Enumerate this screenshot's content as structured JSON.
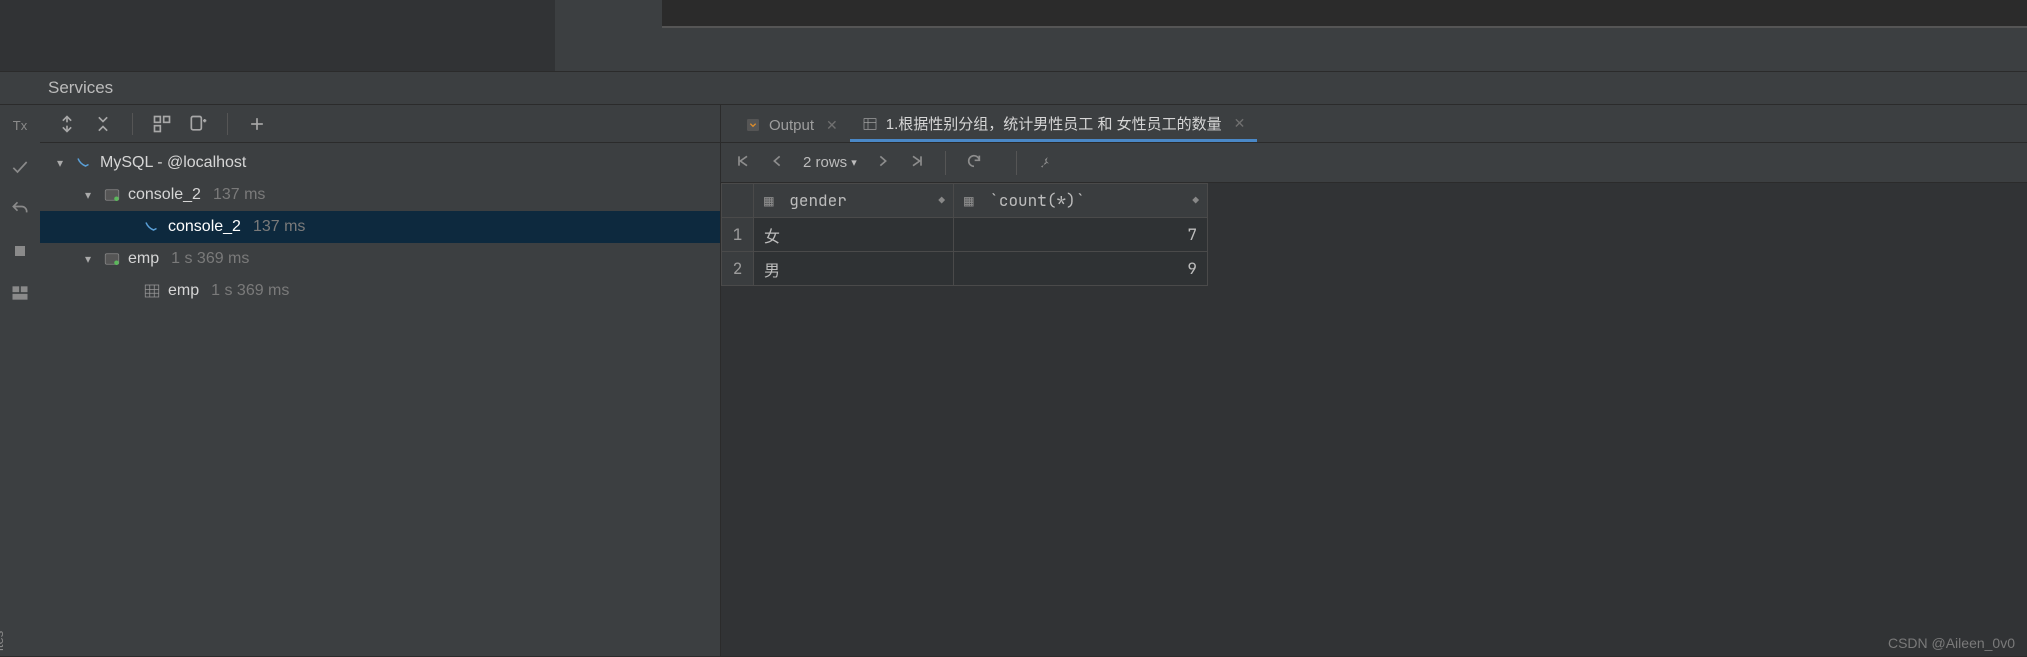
{
  "panel": {
    "title": "Services"
  },
  "toolbar_labels": {
    "tx": "Tx"
  },
  "tree": {
    "root": {
      "label": "MySQL - @localhost"
    },
    "console_group": {
      "label": "console_2",
      "time": "137 ms"
    },
    "console_child": {
      "label": "console_2",
      "time": "137 ms"
    },
    "emp_group": {
      "label": "emp",
      "time": "1 s 369 ms"
    },
    "emp_child": {
      "label": "emp",
      "time": "1 s 369 ms"
    }
  },
  "tabs": {
    "output": "Output",
    "query": "1.根据性别分组，统计男性员工 和 女性员工的数量"
  },
  "grid_toolbar": {
    "rows_label": "2 rows"
  },
  "columns": {
    "gender": "gender",
    "count": "`count(*)`"
  },
  "chart_data": {
    "type": "table",
    "columns": [
      "gender",
      "count(*)"
    ],
    "rows": [
      {
        "n": "1",
        "gender": "女",
        "count": "7"
      },
      {
        "n": "2",
        "gender": "男",
        "count": "9"
      }
    ]
  },
  "watermark": "CSDN @Aileen_0v0",
  "sidebar_label": "ites"
}
